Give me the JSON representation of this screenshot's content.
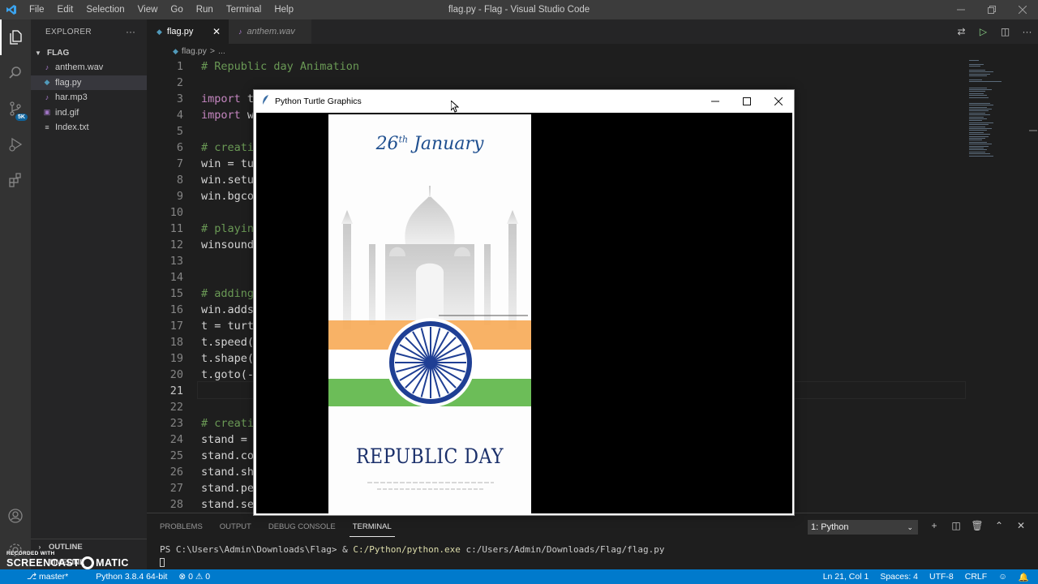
{
  "titlebar": {
    "menus": [
      "File",
      "Edit",
      "Selection",
      "View",
      "Go",
      "Run",
      "Terminal",
      "Help"
    ],
    "window_title": "flag.py - Flag - Visual Studio Code"
  },
  "activity_badge": "5K",
  "explorer": {
    "title": "EXPLORER",
    "more": "···",
    "folder": "FLAG",
    "files": [
      {
        "name": "anthem.wav",
        "icon": "audio-file-icon",
        "color": "#b180d7"
      },
      {
        "name": "flag.py",
        "icon": "python-file-icon",
        "color": "#519aba",
        "selected": true
      },
      {
        "name": "har.mp3",
        "icon": "audio-file-icon",
        "color": "#b180d7"
      },
      {
        "name": "ind.gif",
        "icon": "image-file-icon",
        "color": "#a074c4"
      },
      {
        "name": "Index.txt",
        "icon": "text-file-icon",
        "color": "#cccccc"
      }
    ],
    "outline": "OUTLINE",
    "timeline": "TIMELINE"
  },
  "tabs": [
    {
      "label": "flag.py",
      "active": true
    },
    {
      "label": "anthem.wav",
      "active": false
    }
  ],
  "breadcrumb": {
    "file": "flag.py",
    "sep": ">",
    "rest": "..."
  },
  "editor": {
    "lines": [
      {
        "n": "1",
        "code": "# Republic day Animation",
        "type": "comment"
      },
      {
        "n": "2",
        "code": ""
      },
      {
        "n": "3",
        "code": "import t"
      },
      {
        "n": "4",
        "code": "import w"
      },
      {
        "n": "5",
        "code": ""
      },
      {
        "n": "6",
        "code": "# creati",
        "type": "comment"
      },
      {
        "n": "7",
        "code": "win = tu"
      },
      {
        "n": "8",
        "code": "win.setu"
      },
      {
        "n": "9",
        "code": "win.bgco"
      },
      {
        "n": "10",
        "code": ""
      },
      {
        "n": "11",
        "code": "# playin",
        "type": "comment"
      },
      {
        "n": "12",
        "code": "winsound"
      },
      {
        "n": "13",
        "code": ""
      },
      {
        "n": "14",
        "code": ""
      },
      {
        "n": "15",
        "code": "# adding",
        "type": "comment"
      },
      {
        "n": "16",
        "code": "win.adds"
      },
      {
        "n": "17",
        "code": "t = turt"
      },
      {
        "n": "18",
        "code": "t.speed("
      },
      {
        "n": "19",
        "code": "t.shape("
      },
      {
        "n": "20",
        "code": "t.goto(-"
      },
      {
        "n": "21",
        "code": ""
      },
      {
        "n": "22",
        "code": ""
      },
      {
        "n": "23",
        "code": "# creati",
        "type": "comment"
      },
      {
        "n": "24",
        "code": "stand = "
      },
      {
        "n": "25",
        "code": "stand.co"
      },
      {
        "n": "26",
        "code": "stand.sh"
      },
      {
        "n": "27",
        "code": "stand.pe"
      },
      {
        "n": "28",
        "code": "stand.se"
      }
    ]
  },
  "panel": {
    "tabs": [
      "PROBLEMS",
      "OUTPUT",
      "DEBUG CONSOLE",
      "TERMINAL"
    ],
    "active_tab": "TERMINAL",
    "terminal_select": "1: Python",
    "terminal_prompt": "PS C:\\Users\\Admin\\Downloads\\Flag> & ",
    "terminal_exe": "C:/Python/python.exe",
    "terminal_arg": " c:/Users/Admin/Downloads/Flag/flag.py"
  },
  "statusbar": {
    "branch": "master*",
    "interpreter": "Python 3.8.4 64-bit",
    "errors": "0",
    "warnings": "0",
    "position": "Ln 21, Col 1",
    "spaces": "Spaces: 4",
    "encoding": "UTF-8",
    "eol": "CRLF"
  },
  "watermark": {
    "recorded": "RECORDED WITH",
    "brand_left": "SCREENCAST",
    "brand_right": "MATIC"
  },
  "turtle": {
    "title": "Python Turtle Graphics",
    "poster_day": "26",
    "poster_sup": "th",
    "poster_month": "January",
    "poster_title": "REPUBLIC DAY"
  },
  "colors": {
    "saffron": "#f7a44b",
    "green": "#5cb646",
    "chakra_blue": "#1f3f94",
    "statusbar": "#007acc"
  }
}
